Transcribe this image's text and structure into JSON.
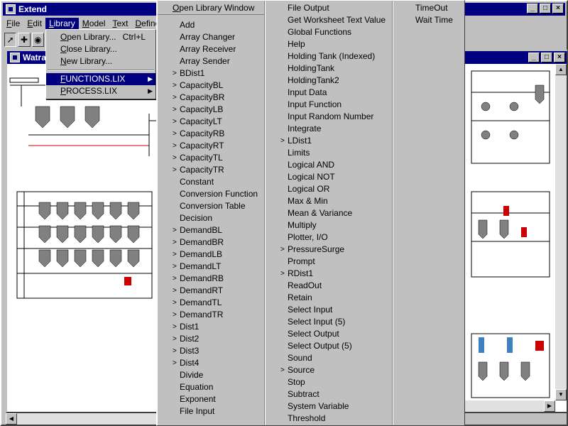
{
  "app": {
    "title": "Extend",
    "controls": {
      "minimize": "_",
      "maximize": "□",
      "close": "×"
    }
  },
  "menubar": [
    {
      "label": "File",
      "underline": "F",
      "rest": "ile"
    },
    {
      "label": "Edit",
      "underline": "E",
      "rest": "dit"
    },
    {
      "label": "Library",
      "underline": "L",
      "rest": "ibrary"
    },
    {
      "label": "Model",
      "underline": "M",
      "rest": "odel"
    },
    {
      "label": "Text",
      "underline": "T",
      "rest": "ext"
    },
    {
      "label": "Define",
      "underline": "D",
      "rest": "efine"
    }
  ],
  "model_window": {
    "title": "Watra"
  },
  "library_menu": {
    "items": [
      {
        "u": "O",
        "rest": "pen Library...",
        "shortcut": "Ctrl+L"
      },
      {
        "u": "C",
        "rest": "lose Library..."
      },
      {
        "u": "N",
        "rest": "ew Library..."
      }
    ],
    "libraries": [
      {
        "u": "F",
        "rest": "UNCTIONS.LIX",
        "arrow": "▶"
      },
      {
        "u": "P",
        "rest": "ROCESS.LIX",
        "arrow": "▶"
      }
    ]
  },
  "functions_menu": {
    "open_window": {
      "u": "O",
      "rest": "pen Library Window"
    },
    "col1": [
      {
        "label": "Add",
        "u": "A",
        "rest": "dd"
      },
      {
        "label": "Array Changer",
        "u": "",
        "rest": "Array Changer"
      },
      {
        "label": "Array Receiver",
        "u": "",
        "rest": "Array Receiver"
      },
      {
        "label": "Array Sender",
        "u": "",
        "rest": "Array Sender"
      },
      {
        "label": "BDist1",
        "u": "B",
        "rest": "Dist1",
        "sub": true
      },
      {
        "label": "CapacityBL",
        "u": "",
        "rest": "CapacityBL",
        "sub": true
      },
      {
        "label": "CapacityBR",
        "u": "",
        "rest": "CapacityBR",
        "sub": true
      },
      {
        "label": "CapacityLB",
        "u": "",
        "rest": "CapacityLB",
        "sub": true
      },
      {
        "label": "CapacityLT",
        "u": "",
        "rest": "CapacityLT",
        "sub": true
      },
      {
        "label": "CapacityRB",
        "u": "",
        "rest": "CapacityRB",
        "sub": true
      },
      {
        "label": "CapacityRT",
        "u": "",
        "rest": "CapacityRT",
        "sub": true
      },
      {
        "label": "CapacityTL",
        "u": "",
        "rest": "CapacityTL",
        "sub": true
      },
      {
        "label": "CapacityTR",
        "u": "",
        "rest": "CapacityTR",
        "sub": true
      },
      {
        "label": "Constant",
        "u": "",
        "rest": "Constant"
      },
      {
        "label": "Conversion Function",
        "u": "",
        "rest": "Conversion Function"
      },
      {
        "label": "Conversion Table",
        "u": "",
        "rest": "Conversion Table"
      },
      {
        "label": "Decision",
        "u": "",
        "rest": "Decision"
      },
      {
        "label": "DemandBL",
        "u": "",
        "rest": "DemandBL",
        "sub": true
      },
      {
        "label": "DemandBR",
        "u": "",
        "rest": "DemandBR",
        "sub": true
      },
      {
        "label": "DemandLB",
        "u": "",
        "rest": "DemandLB",
        "sub": true
      },
      {
        "label": "DemandLT",
        "u": "",
        "rest": "DemandLT",
        "sub": true
      },
      {
        "label": "DemandRB",
        "u": "",
        "rest": "DemandRB",
        "sub": true
      },
      {
        "label": "DemandRT",
        "u": "",
        "rest": "DemandRT",
        "sub": true
      },
      {
        "label": "DemandTL",
        "u": "",
        "rest": "DemandTL",
        "sub": true
      },
      {
        "label": "DemandTR",
        "u": "",
        "rest": "DemandTR",
        "sub": true
      },
      {
        "label": "Dist1",
        "u": "",
        "rest": "Dist1",
        "sub": true
      },
      {
        "label": "Dist2",
        "u": "",
        "rest": "Dist2",
        "sub": true
      },
      {
        "label": "Dist3",
        "u": "",
        "rest": "Dist3",
        "sub": true
      },
      {
        "label": "Dist4",
        "u": "",
        "rest": "Dist4",
        "sub": true
      },
      {
        "label": "Divide",
        "u": "",
        "rest": "Divide"
      },
      {
        "label": "Equation",
        "u": "",
        "rest": "Equation"
      },
      {
        "label": "Exponent",
        "u": "",
        "rest": "Exponent"
      },
      {
        "label": "File Input",
        "u": "",
        "rest": "File Input"
      }
    ],
    "col2": [
      {
        "label": "File Output"
      },
      {
        "label": "Get Worksheet Text Value"
      },
      {
        "label": "Global Functions"
      },
      {
        "label": "Help"
      },
      {
        "label": "Holding Tank (Indexed)"
      },
      {
        "label": "HoldingTank"
      },
      {
        "label": "HoldingTank2"
      },
      {
        "label": "Input Data"
      },
      {
        "label": "Input Function"
      },
      {
        "label": "Input Random Number"
      },
      {
        "label": "Integrate"
      },
      {
        "label": "LDist1",
        "sub": true
      },
      {
        "label": "Limits"
      },
      {
        "label": "Logical AND"
      },
      {
        "label": "Logical NOT"
      },
      {
        "label": "Logical OR"
      },
      {
        "label": "Max & Min"
      },
      {
        "label": "Mean & Variance"
      },
      {
        "label": "Multiply"
      },
      {
        "label": "Plotter, I/O"
      },
      {
        "label": "PressureSurge",
        "sub": true
      },
      {
        "label": "Prompt"
      },
      {
        "label": "RDist1",
        "sub": true
      },
      {
        "label": "ReadOut"
      },
      {
        "label": "Retain"
      },
      {
        "label": "Select Input"
      },
      {
        "label": "Select Input (5)"
      },
      {
        "label": "Select Output"
      },
      {
        "label": "Select Output (5)"
      },
      {
        "label": "Sound"
      },
      {
        "label": "Source",
        "sub": true
      },
      {
        "label": "Stop"
      },
      {
        "label": "Subtract"
      },
      {
        "label": "System Variable"
      },
      {
        "label": "Threshold"
      }
    ],
    "col3": [
      {
        "label": "TimeOut"
      },
      {
        "label": "Wait Time"
      }
    ],
    "submenu_arrow": ">"
  },
  "colors": {
    "title_bar": "#000080",
    "face": "#c0c0c0",
    "highlight": "#000080",
    "diagram_lines": "#000000",
    "diagram_accent": "#cc0000",
    "tank_fill": "#808080"
  }
}
